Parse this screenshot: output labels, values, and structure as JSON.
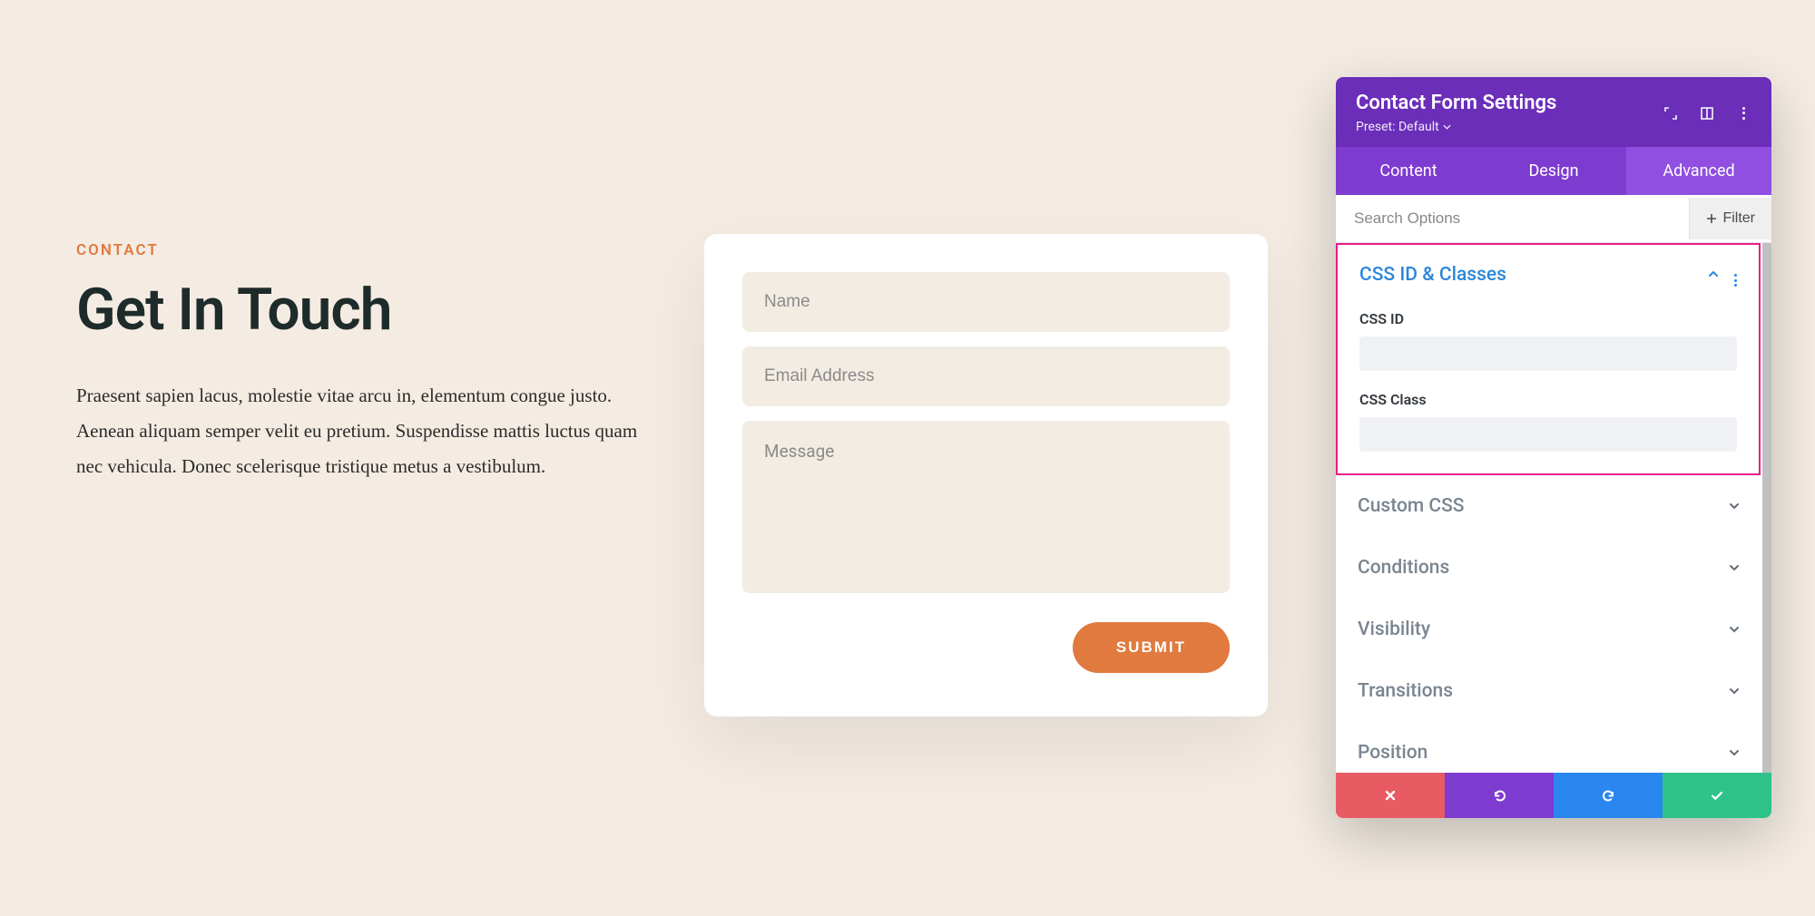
{
  "page": {
    "eyebrow": "CONTACT",
    "heading": "Get In Touch",
    "body": "Praesent sapien lacus, molestie vitae arcu in, elementum congue justo. Aenean aliquam semper velit eu pretium. Suspendisse mattis luctus quam nec vehicula. Donec scelerisque tristique metus a vestibulum."
  },
  "form": {
    "name_placeholder": "Name",
    "email_placeholder": "Email Address",
    "message_placeholder": "Message",
    "submit_label": "SUBMIT"
  },
  "panel": {
    "title": "Contact Form Settings",
    "preset_label": "Preset: Default",
    "tabs": {
      "content": "Content",
      "design": "Design",
      "advanced": "Advanced"
    },
    "search_placeholder": "Search Options",
    "filter_label": "Filter",
    "sections": {
      "css_id_classes": "CSS ID & Classes",
      "css_id_label": "CSS ID",
      "css_class_label": "CSS Class",
      "custom_css": "Custom CSS",
      "conditions": "Conditions",
      "visibility": "Visibility",
      "transitions": "Transitions",
      "position": "Position"
    }
  }
}
